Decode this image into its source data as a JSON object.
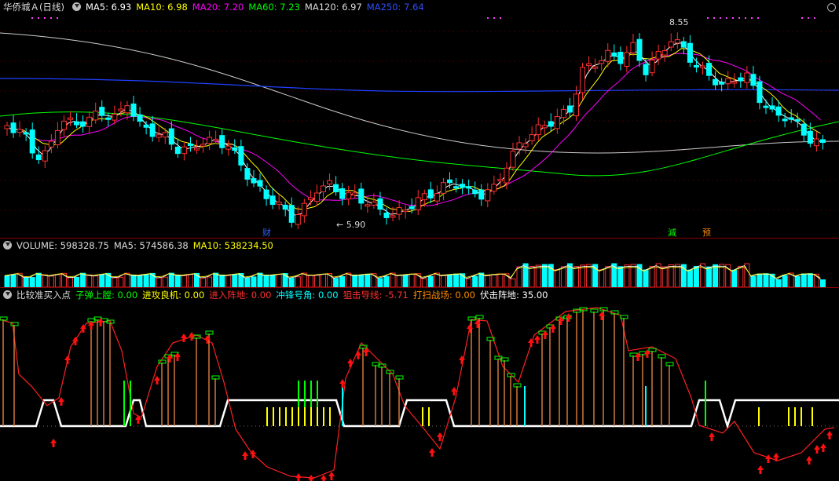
{
  "price_panel": {
    "title": "华侨城Ａ(日线)",
    "indicators": [
      {
        "label": "MA5: 6.93",
        "color": "#ffffff"
      },
      {
        "label": "MA10: 6.98",
        "color": "#ffff00"
      },
      {
        "label": "MA20: 7.20",
        "color": "#ff00ff"
      },
      {
        "label": "MA60: 7.23",
        "color": "#00ff00"
      },
      {
        "label": "MA120: 6.97",
        "color": "#dddddd"
      },
      {
        "label": "MA250: 7.64",
        "color": "#3050ff"
      }
    ],
    "high_label": "8.55",
    "low_label": "5.90",
    "marker_cai": "财",
    "marker_jian": "減",
    "marker_yu": "预"
  },
  "volume_panel": {
    "labels": [
      {
        "label": "VOLUME: 598328.75",
        "color": "#dddddd"
      },
      {
        "label": "MA5: 574586.38",
        "color": "#dddddd"
      },
      {
        "label": "MA10: 538234.50",
        "color": "#ffff00"
      }
    ]
  },
  "signal_panel": {
    "labels": [
      {
        "label": "比较准买入点",
        "color": "#dddddd"
      },
      {
        "label": "子弹上膛: 0.00",
        "color": "#00ff00"
      },
      {
        "label": "进攻良机: 0.00",
        "color": "#ffff00"
      },
      {
        "label": "进入阵地: 0.00",
        "color": "#ff3030"
      },
      {
        "label": "冲锋号角: 0.00",
        "color": "#00ffff"
      },
      {
        "label": "狙击导线: -5.71",
        "color": "#ff3030"
      },
      {
        "label": "打扫战场: 0.00",
        "color": "#ff8c00"
      },
      {
        "label": "伏击阵地: 35.00",
        "color": "#ffffff"
      }
    ]
  },
  "colors": {
    "up": "#ff3030",
    "down": "#00ffff",
    "ma5": "#ffffff",
    "ma10": "#ffff00",
    "ma20": "#ff00ff",
    "ma60": "#00ff00",
    "ma120": "#cccccc",
    "ma250": "#2040ff"
  }
}
